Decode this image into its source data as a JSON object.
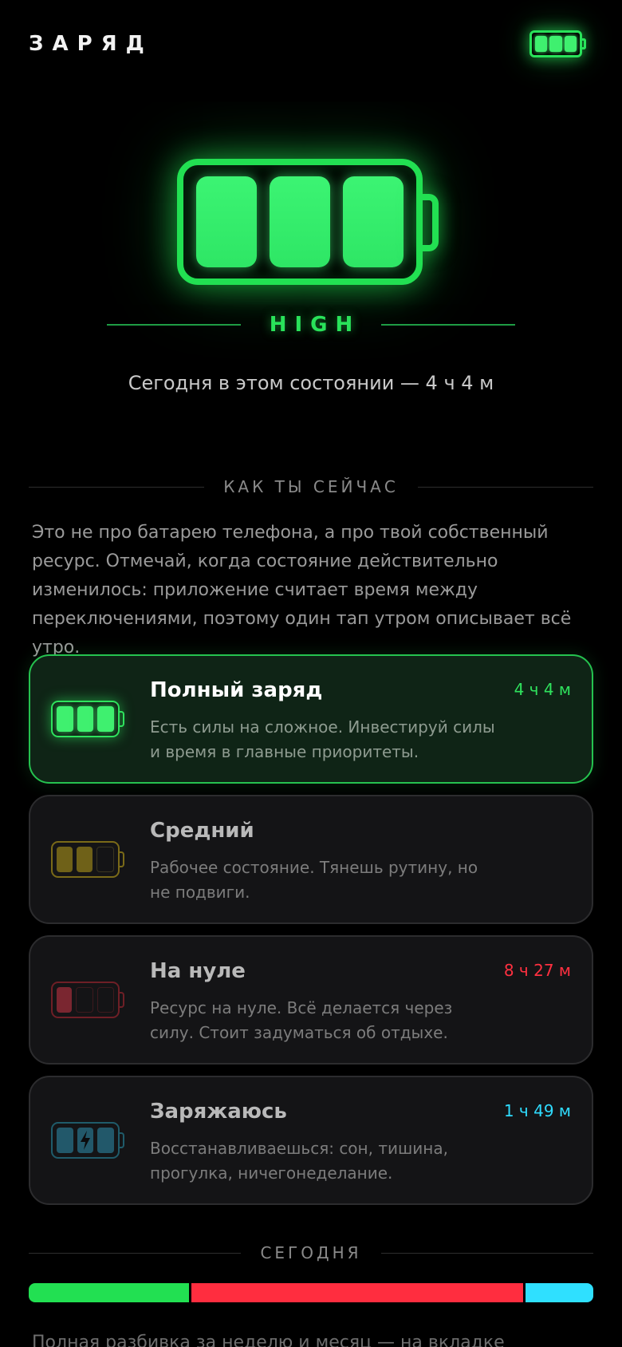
{
  "header": {
    "title": "ЗАРЯД"
  },
  "hero": {
    "state_label": "HIGH",
    "today_text": "Сегодня в этом состоянии — 4 ч 4 м"
  },
  "section_now": {
    "title": "КАК ТЫ СЕЙЧАС"
  },
  "intro": "Это не про батарею телефона, а про твой собственный ресурс. Отмечай, когда состояние действительно изменилось: приложение считает время между переключениями, поэтому один тап утром описывает всё утро.",
  "states": [
    {
      "title": "Полный заряд",
      "desc": "Есть силы на сложное. Инвестируй силы и время в главные приоритеты.",
      "time": "4 ч 4 м",
      "color": "#2fe25d",
      "icon": "battery-full-icon",
      "active": true
    },
    {
      "title": "Средний",
      "desc": "Рабочее состояние. Тянешь рутину, но не подвиги.",
      "time": "",
      "color": "#c9a92a",
      "icon": "battery-medium-icon",
      "active": false
    },
    {
      "title": "На нуле",
      "desc": "Ресурс на нуле. Всё делается через силу. Стоит задуматься об отдыхе.",
      "time": "8 ч 27 м",
      "color": "#ff3040",
      "icon": "battery-empty-icon",
      "active": false
    },
    {
      "title": "Заряжаюсь",
      "desc": "Восстанавливаешься: сон, тишина, прогулка, ничегонеделание.",
      "time": "1 ч 49 м",
      "color": "#2fdcff",
      "icon": "battery-charging-icon",
      "active": false
    }
  ],
  "section_today": {
    "title": "СЕГОДНЯ"
  },
  "timeline": [
    {
      "state": "Полный заряд",
      "fraction": 0.286,
      "color": "#22e052"
    },
    {
      "state": "На нуле",
      "fraction": 0.593,
      "color": "#ff2d3f"
    },
    {
      "state": "Заряжаюсь",
      "fraction": 0.121,
      "color": "#2fe0ff"
    }
  ],
  "footnote": "Полная разбивка за неделю и месяц — на вкладке"
}
